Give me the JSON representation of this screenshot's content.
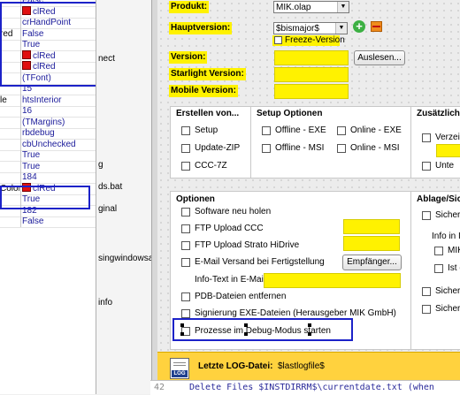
{
  "inspector": {
    "rows": [
      {
        "name": "",
        "value": "False",
        "swatch": false
      },
      {
        "name": "",
        "value": "clRed",
        "swatch": true
      },
      {
        "name": "",
        "value": "crHandPoint",
        "swatch": false
      },
      {
        "name": "red",
        "value": "False",
        "swatch": false
      },
      {
        "name": "",
        "value": "True",
        "swatch": false
      },
      {
        "name": "",
        "value": "clRed",
        "swatch": true
      },
      {
        "name": "",
        "value": "clRed",
        "swatch": true
      },
      {
        "name": "",
        "value": "(TFont)",
        "swatch": false
      },
      {
        "name": "",
        "value": "15",
        "swatch": false
      },
      {
        "name": "le",
        "value": "htsInterior",
        "swatch": false
      },
      {
        "name": "",
        "value": "16",
        "swatch": false
      },
      {
        "name": "",
        "value": "(TMargins)",
        "swatch": false
      },
      {
        "name": "",
        "value": "rbdebug",
        "swatch": false
      },
      {
        "name": "",
        "value": "cbUnchecked",
        "swatch": false
      },
      {
        "name": "",
        "value": "True",
        "swatch": false
      },
      {
        "name": "",
        "value": "True",
        "swatch": false
      },
      {
        "name": "",
        "value": "184",
        "swatch": false
      },
      {
        "name": "Color",
        "value": "clRed",
        "swatch": true
      },
      {
        "name": "",
        "value": "True",
        "swatch": false
      },
      {
        "name": "",
        "value": "182",
        "swatch": false
      },
      {
        "name": "",
        "value": "False",
        "swatch": false
      }
    ]
  },
  "middle": {
    "texts": [
      "nect",
      "g",
      "ds.bat",
      "ginal",
      "singwindowsapi",
      "info"
    ]
  },
  "form": {
    "produkt_label": "Produkt:",
    "produkt_value": "MIK.olap",
    "hauptversion_label": "Hauptversion:",
    "hauptversion_value": "$bismajor$",
    "freeze_label": "Freeze-Version",
    "version_label": "Version:",
    "starlight_label": "Starlight Version:",
    "mobile_label": "Mobile Version:",
    "auslesen_button": "Auslesen...",
    "erstellen": {
      "title": "Erstellen von...",
      "items": [
        "Setup",
        "Update-ZIP",
        "CCC-7Z"
      ]
    },
    "setup_optionen": {
      "title": "Setup Optionen",
      "items": [
        "Offline - EXE",
        "Offline - MSI",
        "Online - EXE",
        "Online - MSI"
      ]
    },
    "zusaetzliche": {
      "title": "Zusätzliche",
      "items": [
        "Verzeic",
        "Unte"
      ]
    },
    "optionen": {
      "title": "Optionen",
      "software_neu": "Software neu holen",
      "ftp_ccc": "FTP Upload CCC",
      "ftp_strato": "FTP Upload Strato HiDrive",
      "email": "E-Mail Versand bei Fertigstellung",
      "empfaenger_button": "Empfänger...",
      "info_text": "Info-Text in E-Mail:",
      "pdb": "PDB-Dateien entfernen",
      "signierung": "Signierung EXE-Dateien (Herausgeber MIK GmbH)",
      "debug": "Prozesse im Debug-Modus starten"
    },
    "ablage": {
      "title": "Ablage/Sic",
      "items": [
        "Sicheru",
        "MIK",
        "Ist e",
        "Sicheru",
        "Sicheru"
      ],
      "info": "Info in I"
    }
  },
  "logbar": {
    "label": "Letzte LOG-Datei:",
    "value": "$lastlogfile$",
    "icon_text": "LOG"
  },
  "code": {
    "line_number": "42",
    "text": "Delete Files $INSTDIRRM$\\currentdate.txt (when"
  },
  "colors": {
    "highlight_yellow": "#fff200",
    "log_bar": "#ffd23e",
    "selection_blue": "#1c22c8",
    "property_red": "#e01010"
  }
}
